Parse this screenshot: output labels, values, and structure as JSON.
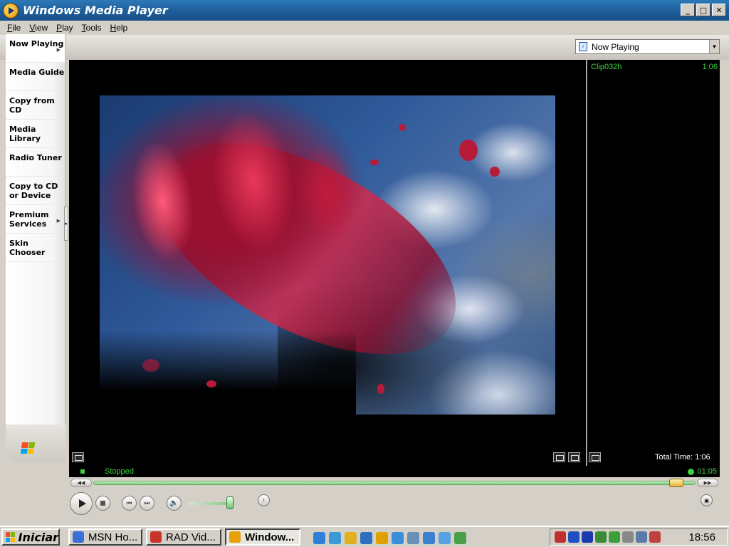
{
  "window": {
    "title": "Windows Media Player",
    "minimize": "_",
    "maximize": "□",
    "close": "✕"
  },
  "menu": [
    "File",
    "View",
    "Play",
    "Tools",
    "Help"
  ],
  "now_playing_selector": {
    "value": "Now Playing"
  },
  "nav": [
    {
      "label": "Now Playing",
      "has_arrow": true
    },
    {
      "label": "Media Guide",
      "has_arrow": false
    },
    {
      "label": "Copy from CD",
      "has_arrow": false
    },
    {
      "label": "Media Library",
      "has_arrow": false
    },
    {
      "label": "Radio Tuner",
      "has_arrow": false
    },
    {
      "label": "Copy to CD or Device",
      "has_arrow": false
    },
    {
      "label": "Premium Services",
      "has_arrow": true
    },
    {
      "label": "Skin Chooser",
      "has_arrow": false
    }
  ],
  "playlist": {
    "items": [
      {
        "title": "Clip032h",
        "duration": "1:06"
      }
    ],
    "total_time": "Total Time: 1:06"
  },
  "status": {
    "text": "Stopped",
    "time": "01:05"
  },
  "seek": {
    "position_fraction": 0.98
  },
  "volume": {
    "level_fraction": 0.9
  },
  "taskbar": {
    "start_label": "Iniciar",
    "tasks": [
      {
        "label": "MSN Ho...",
        "active": false,
        "color": "#3a6fd8"
      },
      {
        "label": "RAD Vid...",
        "active": false,
        "color": "#c8342a"
      },
      {
        "label": "Window...",
        "active": true,
        "color": "#e6a00a"
      }
    ],
    "clock": "18:56"
  },
  "colors": {
    "accent_green": "#3fd23f",
    "title_blue": "#1f5f9c",
    "quicklaunch": [
      "#2f7fd8",
      "#3a9ad8",
      "#e0b020",
      "#2a6fc0",
      "#e0a000",
      "#3a8fd8",
      "#6a8fb8",
      "#3a7fd0",
      "#5aa0e0",
      "#4aa04a"
    ],
    "tray": [
      "#c03030",
      "#2050c0",
      "#1a3ab0",
      "#3a8a3a",
      "#3aa03a",
      "#888888",
      "#5a7aa8",
      "#c04040"
    ]
  }
}
